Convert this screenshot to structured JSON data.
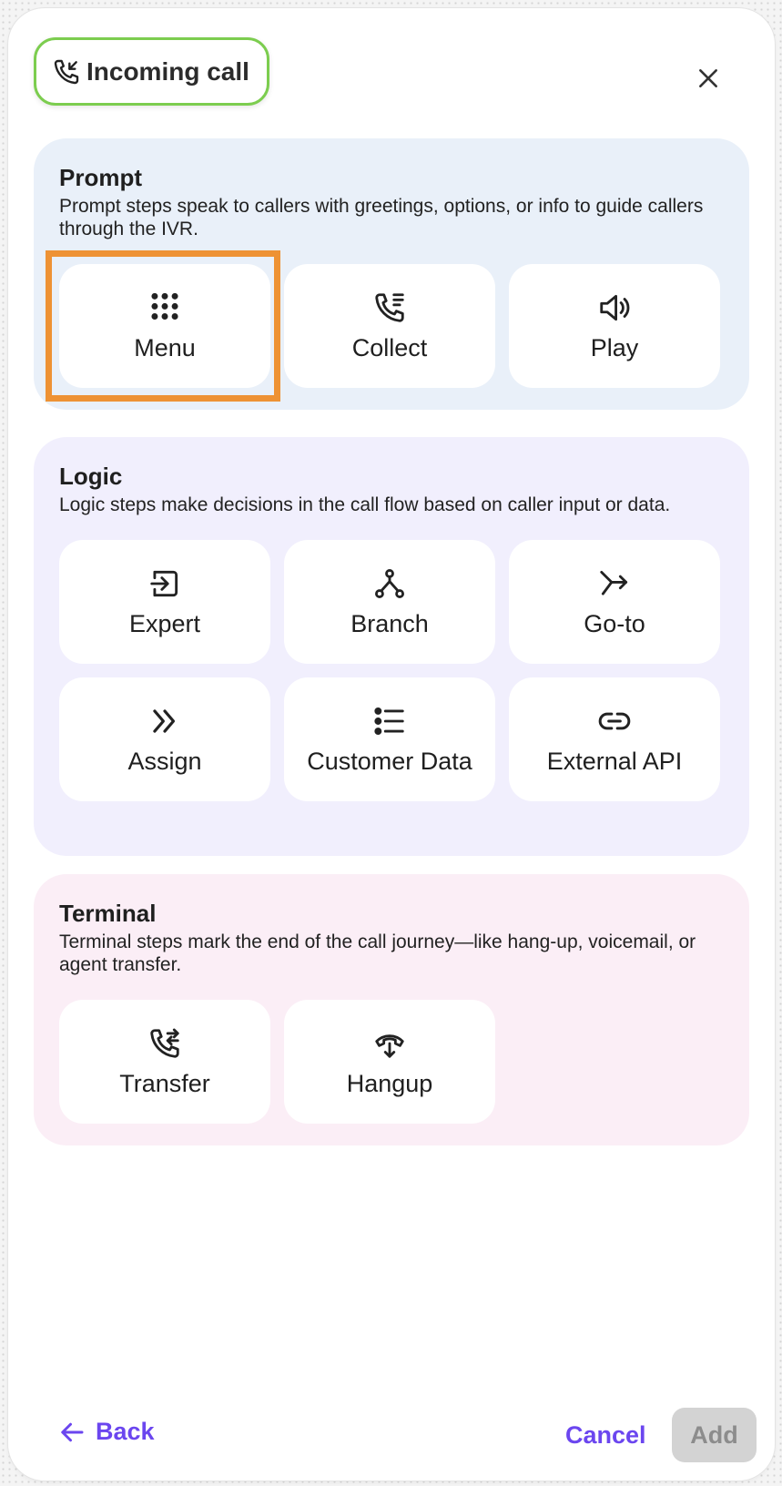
{
  "header": {
    "incoming_call_label": "Incoming call",
    "incoming_icon": "phone-incoming-icon",
    "close_icon": "close-icon"
  },
  "sections": [
    {
      "title": "Prompt",
      "description": "Prompt steps speak to callers with greetings, options, or info to guide callers through the IVR.",
      "background": "#e9f0f9",
      "tiles": [
        {
          "label": "Menu",
          "icon": "dialpad-icon",
          "selected": true
        },
        {
          "label": "Collect",
          "icon": "phone-list-icon"
        },
        {
          "label": "Play",
          "icon": "speaker-icon"
        }
      ]
    },
    {
      "title": "Logic",
      "description": "Logic steps make decisions in the call flow based on caller input or data.",
      "background": "#f1effd",
      "tiles": [
        {
          "label": "Expert",
          "icon": "enter-box-icon"
        },
        {
          "label": "Branch",
          "icon": "branch-icon"
        },
        {
          "label": "Go-to",
          "icon": "redirect-arrow-icon"
        },
        {
          "label": "Assign",
          "icon": "double-chevron-right-icon"
        },
        {
          "label": "Customer Data",
          "icon": "list-icon"
        },
        {
          "label": "External API",
          "icon": "link-icon"
        }
      ]
    },
    {
      "title": "Terminal",
      "description": "Terminal steps mark the end of the call journey—like hang-up, voicemail, or agent transfer.",
      "background": "#fbeef6",
      "tiles": [
        {
          "label": "Transfer",
          "icon": "phone-transfer-icon"
        },
        {
          "label": "Hangup",
          "icon": "hangup-icon"
        }
      ]
    }
  ],
  "footer": {
    "back_label": "Back",
    "cancel_label": "Cancel",
    "add_label": "Add"
  },
  "colors": {
    "accent": "#6b46ef",
    "incoming_border": "#7ccd4f",
    "selection_highlight": "#ee9234",
    "add_disabled_bg": "#d3d3d3"
  }
}
